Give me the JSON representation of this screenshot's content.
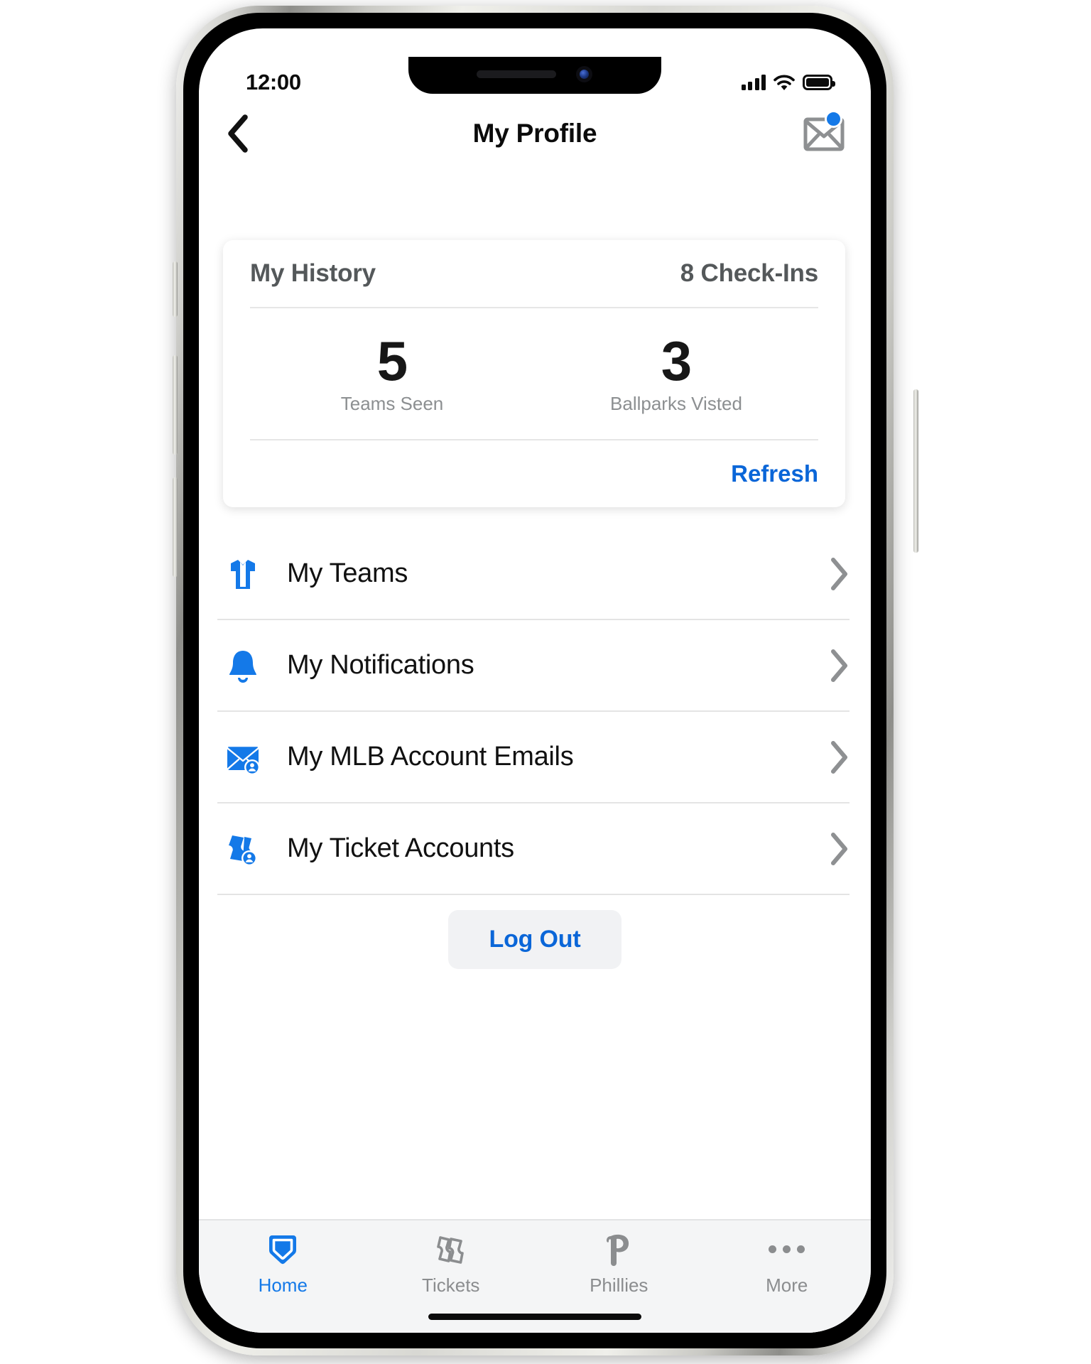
{
  "status_bar": {
    "time": "12:00",
    "cellular_icon": "cellular-bars-icon",
    "wifi_icon": "wifi-icon",
    "battery_icon": "battery-full-icon"
  },
  "nav_bar": {
    "back_icon": "chevron-left-icon",
    "title": "My Profile",
    "mail_icon": "envelope-icon",
    "mail_badge": true
  },
  "theme": {
    "accent_blue": "#0a66d8",
    "brand_red": "#ea1b2d",
    "icon_blue": "#1479e8",
    "muted_gray": "#8b8d8f"
  },
  "history_card": {
    "title": "My History",
    "check_ins": "8 Check-Ins",
    "stats": [
      {
        "value": "5",
        "label": "Teams Seen"
      },
      {
        "value": "3",
        "label": "Ballparks Visted"
      }
    ],
    "refresh_label": "Refresh"
  },
  "menu": {
    "items": [
      {
        "label": "My Teams",
        "icon": "jersey-icon",
        "chevron": "chevron-right-icon"
      },
      {
        "label": "My Notifications",
        "icon": "bell-icon",
        "chevron": "chevron-right-icon"
      },
      {
        "label": "My MLB Account Emails",
        "icon": "envelope-account-icon",
        "chevron": "chevron-right-icon"
      },
      {
        "label": "My Ticket Accounts",
        "icon": "ticket-account-icon",
        "chevron": "chevron-right-icon"
      }
    ]
  },
  "logout": {
    "label": "Log Out"
  },
  "tab_bar": {
    "tabs": [
      {
        "label": "Home",
        "icon": "home-plate-icon",
        "active": true
      },
      {
        "label": "Tickets",
        "icon": "tickets-icon",
        "active": false
      },
      {
        "label": "Phillies",
        "icon": "phillies-p-icon",
        "active": false
      },
      {
        "label": "More",
        "icon": "ellipsis-icon",
        "active": false
      }
    ]
  }
}
